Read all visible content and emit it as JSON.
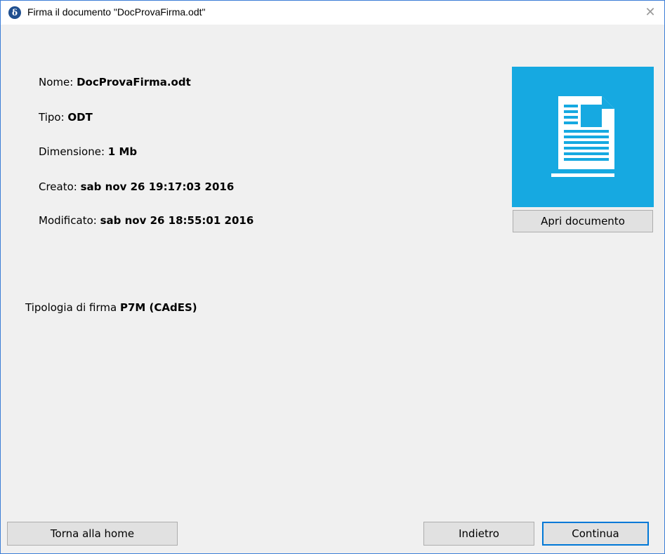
{
  "window": {
    "title": "Firma il documento \"DocProvaFirma.odt\"",
    "app_icon_glyph": "δ",
    "close_glyph": "✕",
    "accent_color": "#0078d7"
  },
  "file_info": {
    "name_label": "Nome:",
    "name_value": "DocProvaFirma.odt",
    "type_label": "Tipo:",
    "type_value": "ODT",
    "size_label": "Dimensione:",
    "size_value": "1 Mb",
    "created_label": "Creato:",
    "created_value": "sab nov 26 19:17:03 2016",
    "modified_label": "Modificato:",
    "modified_value": "sab nov 26 18:55:01 2016"
  },
  "preview": {
    "icon": "document-icon",
    "tile_color": "#16a9e1",
    "open_button_label": "Apri documento"
  },
  "signature": {
    "label": "Tipologia di firma",
    "value": "P7M (CAdES)"
  },
  "footer": {
    "home_button_label": "Torna alla home",
    "back_button_label": "Indietro",
    "continue_button_label": "Continua"
  }
}
